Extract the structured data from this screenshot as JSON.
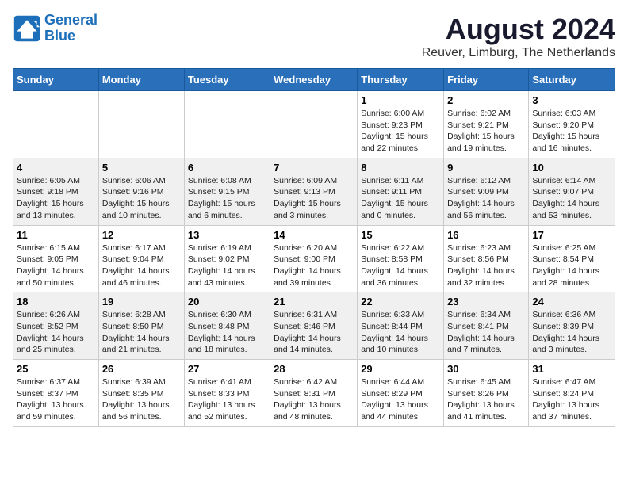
{
  "header": {
    "logo_line1": "General",
    "logo_line2": "Blue",
    "month": "August 2024",
    "location": "Reuver, Limburg, The Netherlands"
  },
  "weekdays": [
    "Sunday",
    "Monday",
    "Tuesday",
    "Wednesday",
    "Thursday",
    "Friday",
    "Saturday"
  ],
  "weeks": [
    [
      {
        "day": "",
        "info": ""
      },
      {
        "day": "",
        "info": ""
      },
      {
        "day": "",
        "info": ""
      },
      {
        "day": "",
        "info": ""
      },
      {
        "day": "1",
        "info": "Sunrise: 6:00 AM\nSunset: 9:23 PM\nDaylight: 15 hours\nand 22 minutes."
      },
      {
        "day": "2",
        "info": "Sunrise: 6:02 AM\nSunset: 9:21 PM\nDaylight: 15 hours\nand 19 minutes."
      },
      {
        "day": "3",
        "info": "Sunrise: 6:03 AM\nSunset: 9:20 PM\nDaylight: 15 hours\nand 16 minutes."
      }
    ],
    [
      {
        "day": "4",
        "info": "Sunrise: 6:05 AM\nSunset: 9:18 PM\nDaylight: 15 hours\nand 13 minutes."
      },
      {
        "day": "5",
        "info": "Sunrise: 6:06 AM\nSunset: 9:16 PM\nDaylight: 15 hours\nand 10 minutes."
      },
      {
        "day": "6",
        "info": "Sunrise: 6:08 AM\nSunset: 9:15 PM\nDaylight: 15 hours\nand 6 minutes."
      },
      {
        "day": "7",
        "info": "Sunrise: 6:09 AM\nSunset: 9:13 PM\nDaylight: 15 hours\nand 3 minutes."
      },
      {
        "day": "8",
        "info": "Sunrise: 6:11 AM\nSunset: 9:11 PM\nDaylight: 15 hours\nand 0 minutes."
      },
      {
        "day": "9",
        "info": "Sunrise: 6:12 AM\nSunset: 9:09 PM\nDaylight: 14 hours\nand 56 minutes."
      },
      {
        "day": "10",
        "info": "Sunrise: 6:14 AM\nSunset: 9:07 PM\nDaylight: 14 hours\nand 53 minutes."
      }
    ],
    [
      {
        "day": "11",
        "info": "Sunrise: 6:15 AM\nSunset: 9:05 PM\nDaylight: 14 hours\nand 50 minutes."
      },
      {
        "day": "12",
        "info": "Sunrise: 6:17 AM\nSunset: 9:04 PM\nDaylight: 14 hours\nand 46 minutes."
      },
      {
        "day": "13",
        "info": "Sunrise: 6:19 AM\nSunset: 9:02 PM\nDaylight: 14 hours\nand 43 minutes."
      },
      {
        "day": "14",
        "info": "Sunrise: 6:20 AM\nSunset: 9:00 PM\nDaylight: 14 hours\nand 39 minutes."
      },
      {
        "day": "15",
        "info": "Sunrise: 6:22 AM\nSunset: 8:58 PM\nDaylight: 14 hours\nand 36 minutes."
      },
      {
        "day": "16",
        "info": "Sunrise: 6:23 AM\nSunset: 8:56 PM\nDaylight: 14 hours\nand 32 minutes."
      },
      {
        "day": "17",
        "info": "Sunrise: 6:25 AM\nSunset: 8:54 PM\nDaylight: 14 hours\nand 28 minutes."
      }
    ],
    [
      {
        "day": "18",
        "info": "Sunrise: 6:26 AM\nSunset: 8:52 PM\nDaylight: 14 hours\nand 25 minutes."
      },
      {
        "day": "19",
        "info": "Sunrise: 6:28 AM\nSunset: 8:50 PM\nDaylight: 14 hours\nand 21 minutes."
      },
      {
        "day": "20",
        "info": "Sunrise: 6:30 AM\nSunset: 8:48 PM\nDaylight: 14 hours\nand 18 minutes."
      },
      {
        "day": "21",
        "info": "Sunrise: 6:31 AM\nSunset: 8:46 PM\nDaylight: 14 hours\nand 14 minutes."
      },
      {
        "day": "22",
        "info": "Sunrise: 6:33 AM\nSunset: 8:44 PM\nDaylight: 14 hours\nand 10 minutes."
      },
      {
        "day": "23",
        "info": "Sunrise: 6:34 AM\nSunset: 8:41 PM\nDaylight: 14 hours\nand 7 minutes."
      },
      {
        "day": "24",
        "info": "Sunrise: 6:36 AM\nSunset: 8:39 PM\nDaylight: 14 hours\nand 3 minutes."
      }
    ],
    [
      {
        "day": "25",
        "info": "Sunrise: 6:37 AM\nSunset: 8:37 PM\nDaylight: 13 hours\nand 59 minutes."
      },
      {
        "day": "26",
        "info": "Sunrise: 6:39 AM\nSunset: 8:35 PM\nDaylight: 13 hours\nand 56 minutes."
      },
      {
        "day": "27",
        "info": "Sunrise: 6:41 AM\nSunset: 8:33 PM\nDaylight: 13 hours\nand 52 minutes."
      },
      {
        "day": "28",
        "info": "Sunrise: 6:42 AM\nSunset: 8:31 PM\nDaylight: 13 hours\nand 48 minutes."
      },
      {
        "day": "29",
        "info": "Sunrise: 6:44 AM\nSunset: 8:29 PM\nDaylight: 13 hours\nand 44 minutes."
      },
      {
        "day": "30",
        "info": "Sunrise: 6:45 AM\nSunset: 8:26 PM\nDaylight: 13 hours\nand 41 minutes."
      },
      {
        "day": "31",
        "info": "Sunrise: 6:47 AM\nSunset: 8:24 PM\nDaylight: 13 hours\nand 37 minutes."
      }
    ]
  ]
}
